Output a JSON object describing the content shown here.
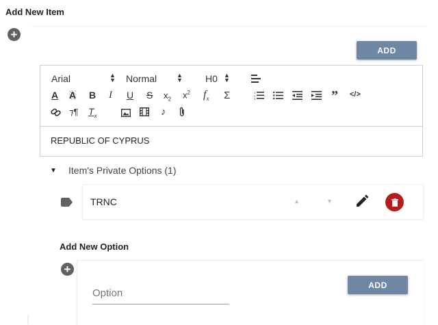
{
  "header": {
    "title": "Add New Item"
  },
  "item": {
    "add_button": "ADD"
  },
  "editor": {
    "font_select": "Arial",
    "size_select": "Normal",
    "heading_select": "H0",
    "content": "REPUBLIC OF CYPRUS"
  },
  "private_options": {
    "label": "Item's Private Options (1)",
    "items": [
      {
        "label": "TRNC"
      }
    ]
  },
  "new_option": {
    "title": "Add New Option",
    "input_placeholder": "Option",
    "add_button": "ADD"
  },
  "colors": {
    "accent": "#6f87a4",
    "danger": "#b71c1c",
    "icon": "#616161"
  },
  "icons": [
    "plus-icon",
    "align-icon",
    "font-color-icon",
    "background-color-icon",
    "bold-icon",
    "italic-icon",
    "underline-icon",
    "strike-icon",
    "subscript-icon",
    "superscript-icon",
    "formula-icon",
    "sum-icon",
    "ordered-list-icon",
    "bullet-list-icon",
    "outdent-icon",
    "indent-icon",
    "blockquote-icon",
    "code-icon",
    "link-icon",
    "direction-icon",
    "clear-format-icon",
    "image-icon",
    "video-icon",
    "audio-icon",
    "attachment-icon",
    "caret-down-icon",
    "tag-icon",
    "arrow-up-icon",
    "arrow-down-icon",
    "edit-icon",
    "delete-icon"
  ]
}
